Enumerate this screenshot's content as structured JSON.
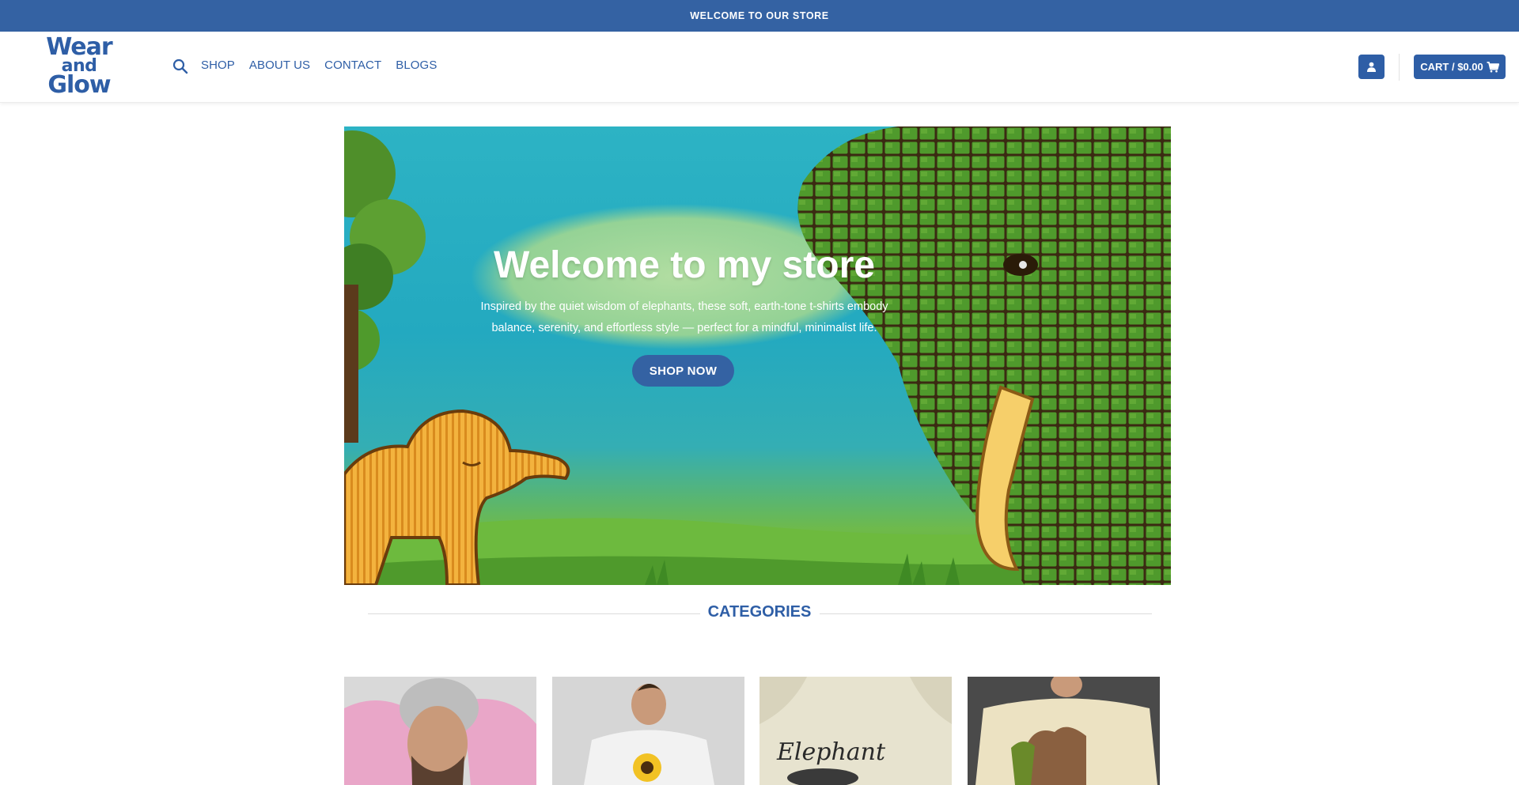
{
  "topbar": {
    "text": "WELCOME TO OUR STORE"
  },
  "header": {
    "logo": {
      "line1": "Wear",
      "line2": "and",
      "line3": "Glow"
    },
    "nav": [
      {
        "label": "SHOP"
      },
      {
        "label": "ABOUT US"
      },
      {
        "label": "CONTACT"
      },
      {
        "label": "BLOGS"
      }
    ],
    "cart_label": "CART / $0.00",
    "icons": {
      "search": "search-icon",
      "account": "user-icon",
      "cart": "cart-icon"
    }
  },
  "hero": {
    "title": "Welcome to my store",
    "subtitle": "Inspired by the quiet wisdom of elephants, these soft, earth-tone t-shirts embody balance, serenity, and effortless style — perfect for a mindful, minimalist life.",
    "button_label": "SHOP NOW"
  },
  "categories": {
    "title": "CATEGORIES",
    "items": [
      {
        "image": "pink-hoodie-man"
      },
      {
        "image": "sunflower-tshirt"
      },
      {
        "image": "elephant-text-sweatshirt",
        "print": "Elephant"
      },
      {
        "image": "elephant-sunset-sweatshirt"
      }
    ]
  },
  "colors": {
    "brand": "#2e5ea6",
    "topbar": "#3462a3"
  }
}
